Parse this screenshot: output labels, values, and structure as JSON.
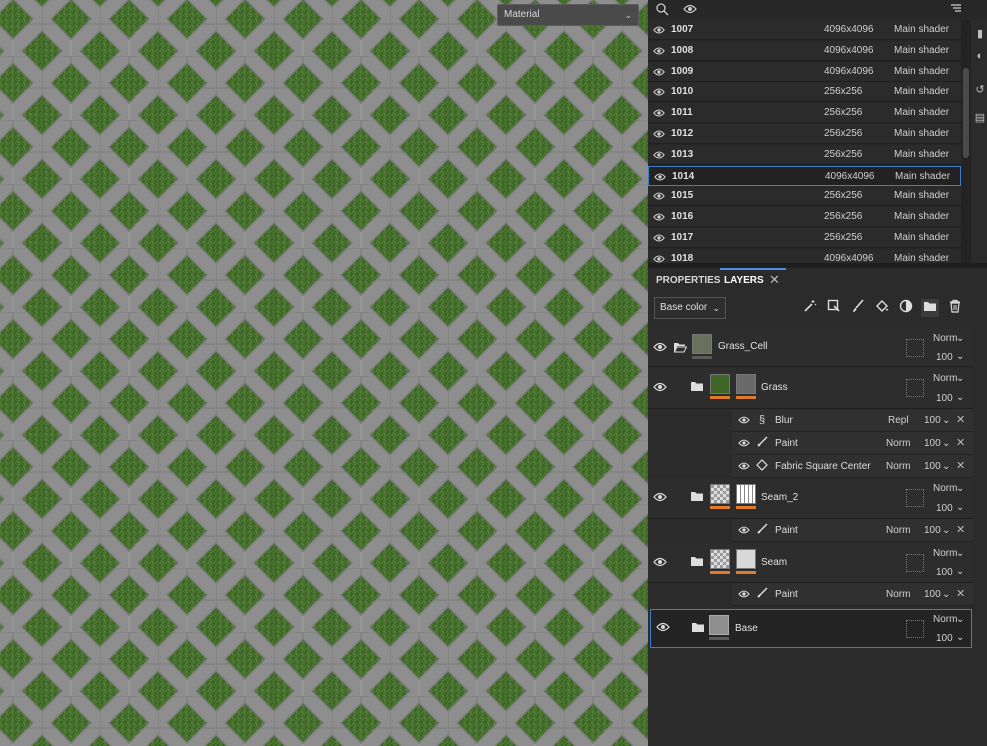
{
  "viewport": {
    "material_mode": "Material",
    "colors": {
      "grass": "#4e7a34",
      "grass_dark": "#37571f",
      "paver": "#8f8f8f",
      "paver_light": "#a3a3a3"
    }
  },
  "uv_toolbar": {
    "icons": [
      "uv-island-icon",
      "eye-icon",
      "filter-list-icon"
    ]
  },
  "tiles": {
    "selected_id": "1014",
    "rows": [
      {
        "id": "1007",
        "resolution": "4096x4096",
        "shader": "Main shader"
      },
      {
        "id": "1008",
        "resolution": "4096x4096",
        "shader": "Main shader"
      },
      {
        "id": "1009",
        "resolution": "4096x4096",
        "shader": "Main shader"
      },
      {
        "id": "1010",
        "resolution": "256x256",
        "shader": "Main shader"
      },
      {
        "id": "1011",
        "resolution": "256x256",
        "shader": "Main shader"
      },
      {
        "id": "1012",
        "resolution": "256x256",
        "shader": "Main shader"
      },
      {
        "id": "1013",
        "resolution": "256x256",
        "shader": "Main shader"
      },
      {
        "id": "1014",
        "resolution": "4096x4096",
        "shader": "Main shader"
      },
      {
        "id": "1015",
        "resolution": "256x256",
        "shader": "Main shader"
      },
      {
        "id": "1016",
        "resolution": "256x256",
        "shader": "Main shader"
      },
      {
        "id": "1017",
        "resolution": "256x256",
        "shader": "Main shader"
      },
      {
        "id": "1018",
        "resolution": "4096x4096",
        "shader": "Main shader"
      }
    ]
  },
  "tabs": {
    "properties": "PROPERTIES",
    "layers": "LAYERS",
    "close": "✕"
  },
  "layer_toolbar": {
    "channel": "Base color",
    "tools": [
      "magic-wand-icon",
      "fill-projection-icon",
      "brush-icon",
      "fill-bucket-icon",
      "smart-material-icon",
      "folder-icon",
      "trash-icon"
    ]
  },
  "layers": {
    "grass_cell": {
      "name": "Grass_Cell",
      "mode": "Norm",
      "opacity": "100"
    },
    "grass": {
      "name": "Grass",
      "mode": "Norm",
      "opacity": "100",
      "effects": [
        {
          "name": "Blur",
          "mode": "Repl",
          "opacity": "100",
          "icon": "filter-icon"
        },
        {
          "name": "Paint",
          "mode": "Norm",
          "opacity": "100",
          "icon": "brush-icon"
        },
        {
          "name": "Fabric Square Center",
          "mode": "Norm",
          "opacity": "100",
          "icon": "fill-icon"
        }
      ]
    },
    "seam2": {
      "name": "Seam_2",
      "mode": "Norm",
      "opacity": "100",
      "effects": [
        {
          "name": "Paint",
          "mode": "Norm",
          "opacity": "100",
          "icon": "brush-icon"
        }
      ]
    },
    "seam": {
      "name": "Seam",
      "mode": "Norm",
      "opacity": "100",
      "effects": [
        {
          "name": "Paint",
          "mode": "Norm",
          "opacity": "100",
          "icon": "brush-icon"
        }
      ]
    },
    "base": {
      "name": "Base",
      "mode": "Norm",
      "opacity": "100"
    }
  },
  "glyphs": {
    "chevron": "⌄",
    "close": "✕"
  },
  "accent": {
    "selection": "#3d7ec7",
    "mask_bar": "#e07b2b"
  }
}
